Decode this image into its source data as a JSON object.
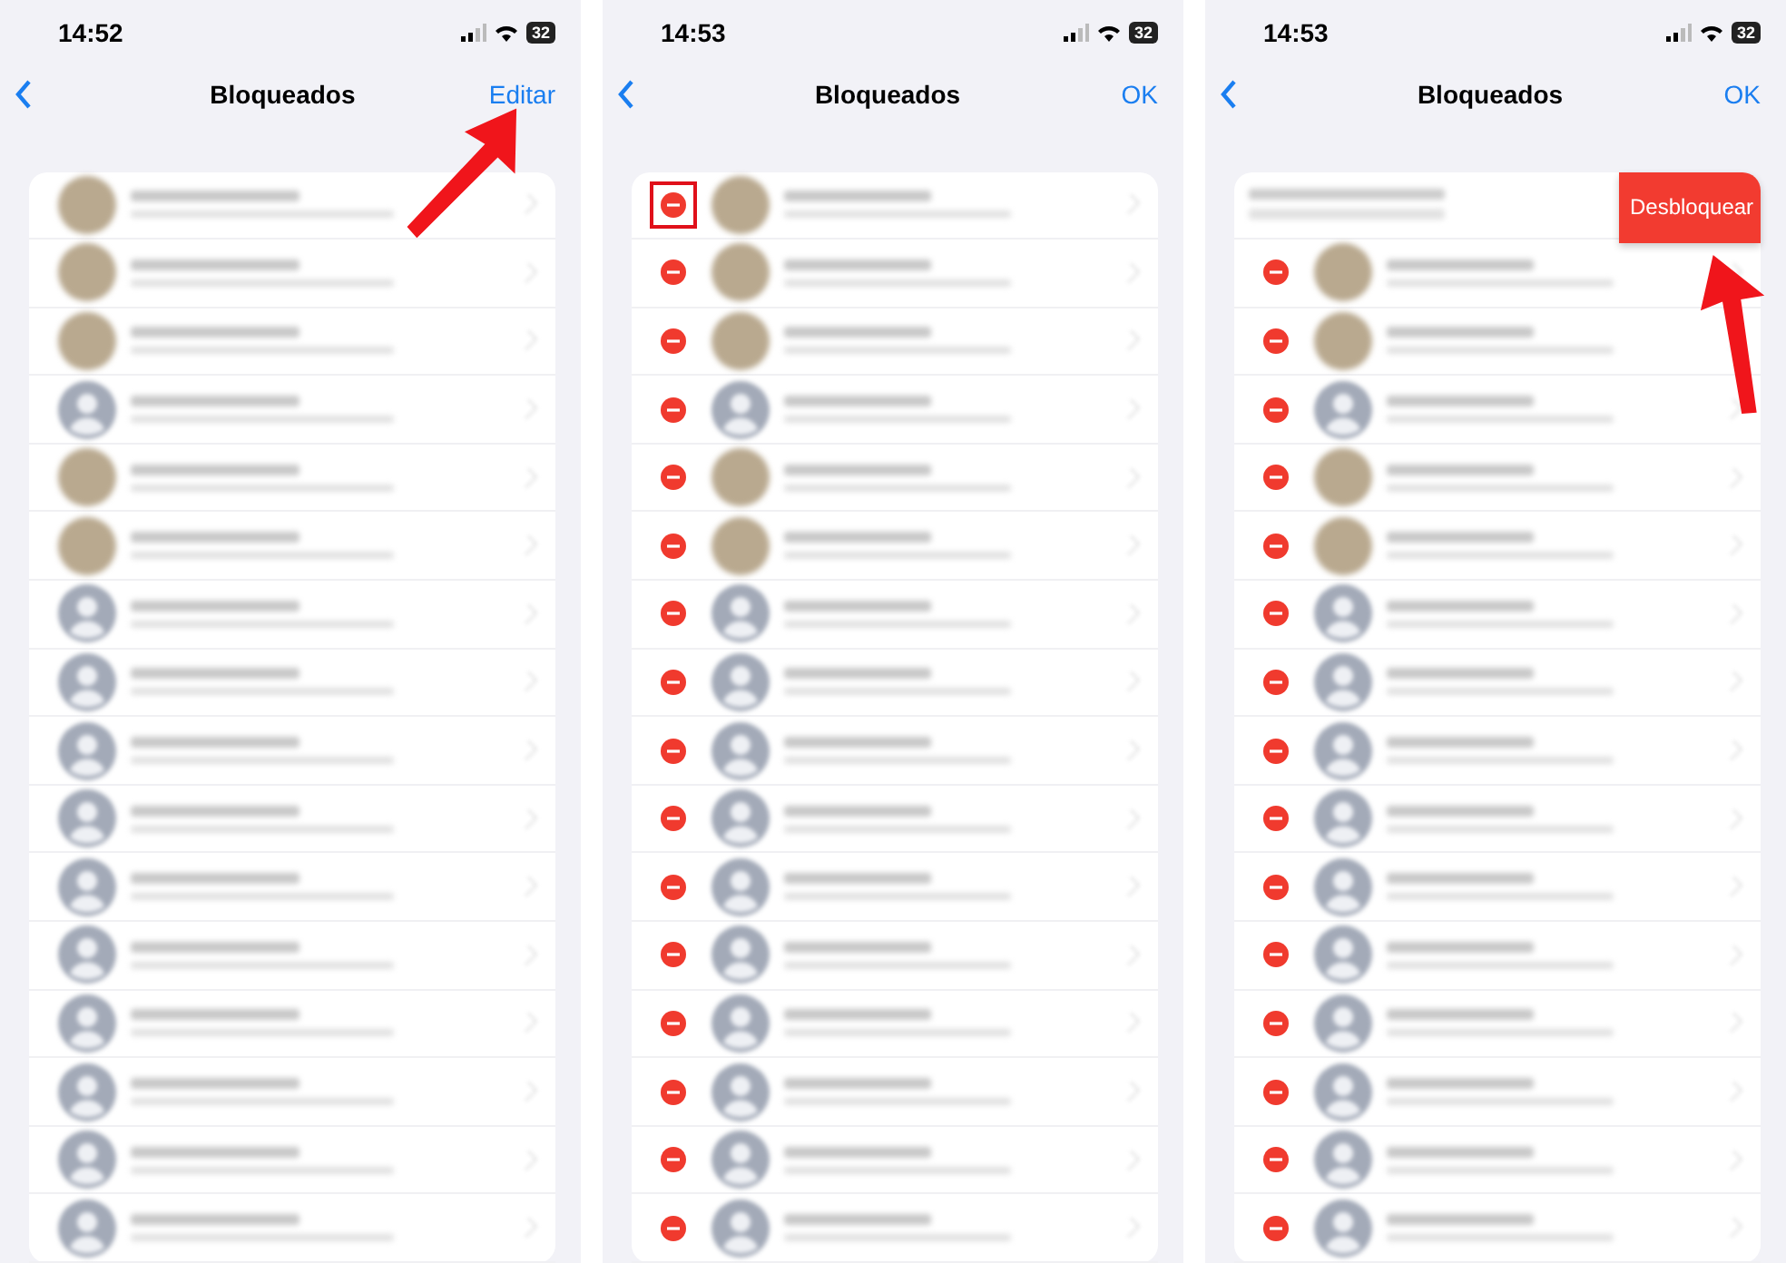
{
  "panels": [
    {
      "time": "14:52",
      "battery": "32",
      "title": "Bloqueados",
      "action": "Editar",
      "editing": false,
      "arrow_to_action": true,
      "rows": [
        {
          "kind": "photo"
        },
        {
          "kind": "photo"
        },
        {
          "kind": "photo"
        },
        {
          "kind": "person"
        },
        {
          "kind": "photo"
        },
        {
          "kind": "photo"
        },
        {
          "kind": "person"
        },
        {
          "kind": "person"
        },
        {
          "kind": "person"
        },
        {
          "kind": "person"
        },
        {
          "kind": "person"
        },
        {
          "kind": "person"
        },
        {
          "kind": "person"
        },
        {
          "kind": "person"
        },
        {
          "kind": "person"
        },
        {
          "kind": "person"
        }
      ]
    },
    {
      "time": "14:53",
      "battery": "32",
      "title": "Bloqueados",
      "action": "OK",
      "editing": true,
      "highlight_first": true,
      "rows": [
        {
          "kind": "photo"
        },
        {
          "kind": "photo"
        },
        {
          "kind": "photo"
        },
        {
          "kind": "person"
        },
        {
          "kind": "photo"
        },
        {
          "kind": "photo"
        },
        {
          "kind": "person"
        },
        {
          "kind": "person"
        },
        {
          "kind": "person"
        },
        {
          "kind": "person"
        },
        {
          "kind": "person"
        },
        {
          "kind": "person"
        },
        {
          "kind": "person"
        },
        {
          "kind": "person"
        },
        {
          "kind": "person"
        },
        {
          "kind": "person"
        }
      ]
    },
    {
      "time": "14:53",
      "battery": "32",
      "title": "Bloqueados",
      "action": "OK",
      "editing": true,
      "arrow_to_unblock": true,
      "rows": [
        {
          "kind": "swiped",
          "unblock": "Desbloquear"
        },
        {
          "kind": "photo"
        },
        {
          "kind": "photo"
        },
        {
          "kind": "person"
        },
        {
          "kind": "photo"
        },
        {
          "kind": "photo"
        },
        {
          "kind": "person"
        },
        {
          "kind": "person"
        },
        {
          "kind": "person"
        },
        {
          "kind": "person"
        },
        {
          "kind": "person"
        },
        {
          "kind": "person"
        },
        {
          "kind": "person"
        },
        {
          "kind": "person"
        },
        {
          "kind": "person"
        },
        {
          "kind": "person"
        }
      ]
    }
  ]
}
